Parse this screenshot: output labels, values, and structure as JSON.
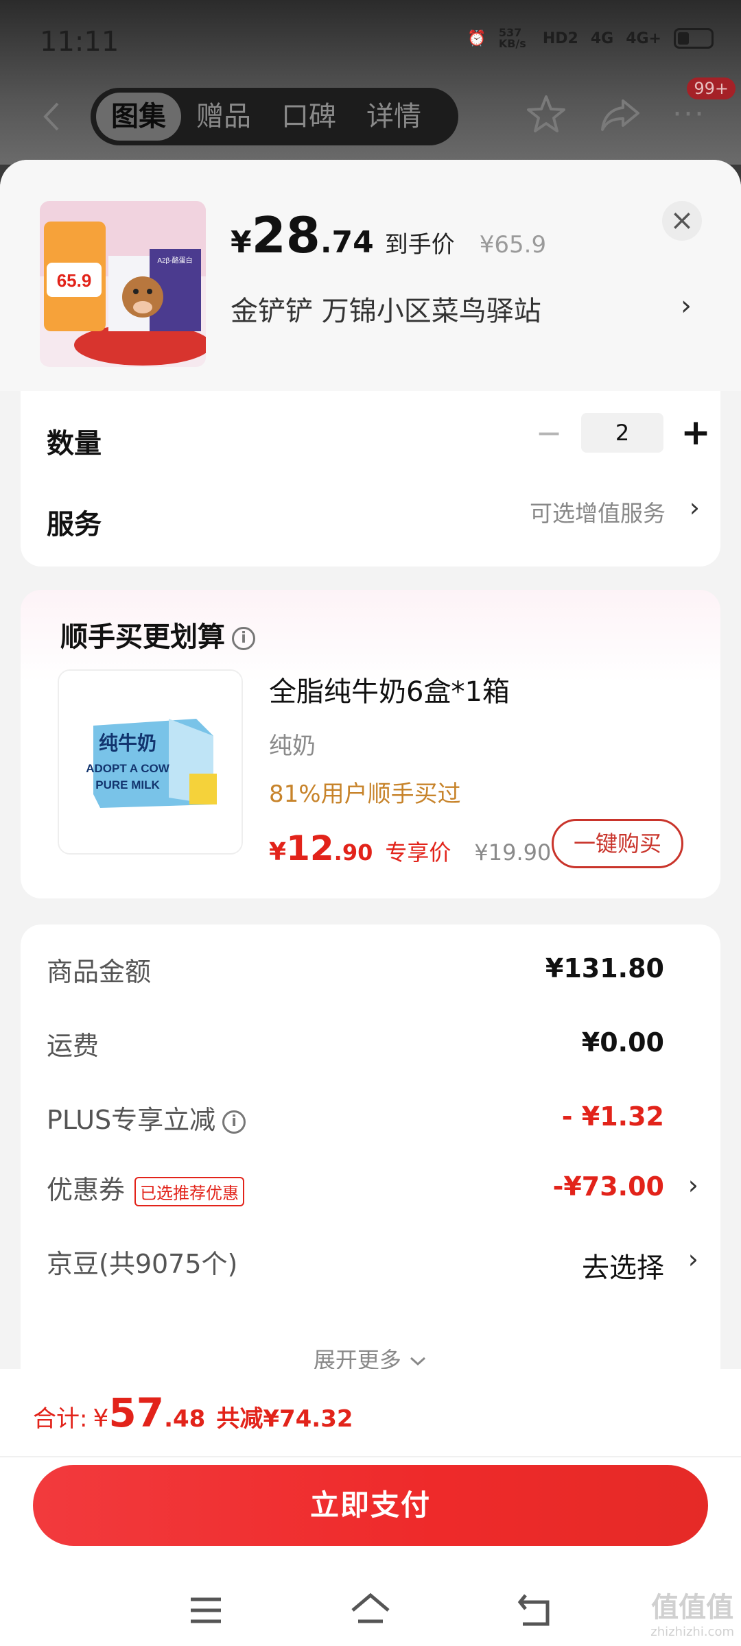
{
  "status_bar": {
    "time": "11:11",
    "net_speed": "537 KB/s",
    "hd": "HD2",
    "sig1": "4G",
    "sig2": "4G+"
  },
  "top_nav": {
    "tabs": [
      {
        "label": "图集"
      },
      {
        "label": "赠品"
      },
      {
        "label": "口碑"
      },
      {
        "label": "详情"
      }
    ],
    "badge": "99+"
  },
  "product": {
    "price_symbol": "¥",
    "price_int": "28",
    "price_dec": ".74",
    "price_tag": "到手价",
    "orig_price": "¥65.9",
    "address": "金铲铲  万锦小区菜鸟驿站",
    "image_text": {
      "promo": "65.9",
      "box": "A2β-酪蛋白"
    }
  },
  "options": {
    "qty_label": "数量",
    "qty_value": "2",
    "service_label": "服务",
    "service_hint": "可选增值服务"
  },
  "recommend": {
    "title": "顺手买更划算",
    "name": "全脂纯牛奶6盒*1箱",
    "category": "纯奶",
    "pct_text": "81%用户顺手买过",
    "price_symbol": "¥",
    "price_int": "12",
    "price_dec": ".90",
    "price_tag": "专享价",
    "orig_price": "¥19.90",
    "buy_label": "一键购买",
    "image_text": {
      "line1": "纯牛奶",
      "line2": "ADOPT A COW",
      "line3": "PURE MILK"
    }
  },
  "fees": {
    "goods_label": "商品金额",
    "goods_value": "¥131.80",
    "ship_label": "运费",
    "ship_value": "¥0.00",
    "plus_label": "PLUS专享立减",
    "plus_value": "- ¥1.32",
    "coupon_label": "优惠券",
    "coupon_tag": "已选推荐优惠",
    "coupon_value": "-¥73.00",
    "bean_label": "京豆(共9075个)",
    "bean_value": "去选择",
    "expand_label": "展开更多"
  },
  "footer": {
    "total_label": "合计:",
    "total_symbol": "¥",
    "total_int": "57",
    "total_dec": ".48",
    "save_text": "共减¥74.32",
    "pay_label": "立即支付"
  },
  "watermark": {
    "main": "值值值",
    "sub": "zhizhizhi.com"
  },
  "colors": {
    "accent_red": "#e2231a",
    "pct_orange": "#c7832a",
    "pay_btn": "#ee2a2a"
  }
}
